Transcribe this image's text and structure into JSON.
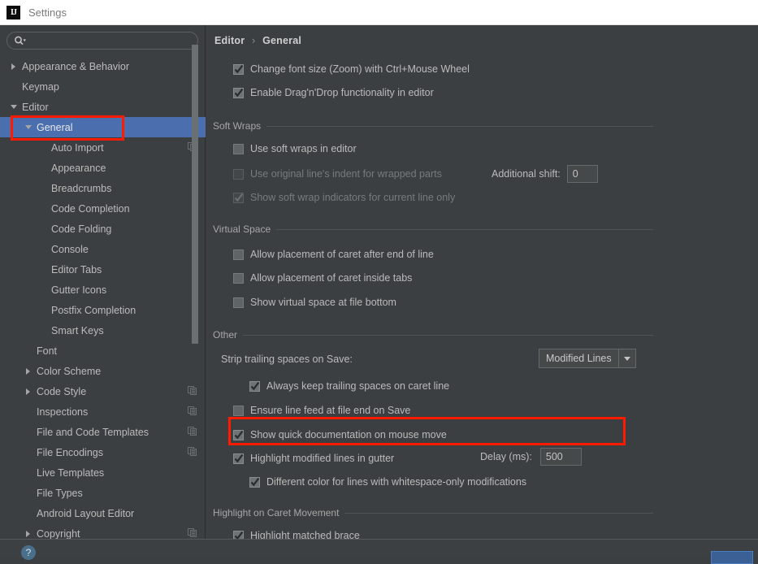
{
  "window": {
    "title": "Settings",
    "logo_text": "IJ"
  },
  "sidebar": {
    "search": {
      "placeholder": "",
      "value": "",
      "icon": "search-icon"
    },
    "items": [
      {
        "label": "Appearance & Behavior",
        "depth": 0,
        "arrow": "right",
        "selected": false,
        "copy": false
      },
      {
        "label": "Keymap",
        "depth": 0,
        "arrow": "none",
        "selected": false,
        "copy": false
      },
      {
        "label": "Editor",
        "depth": 0,
        "arrow": "down",
        "selected": false,
        "copy": false
      },
      {
        "label": "General",
        "depth": 1,
        "arrow": "down",
        "selected": true,
        "copy": false
      },
      {
        "label": "Auto Import",
        "depth": 2,
        "arrow": "none",
        "selected": false,
        "copy": true
      },
      {
        "label": "Appearance",
        "depth": 2,
        "arrow": "none",
        "selected": false,
        "copy": false
      },
      {
        "label": "Breadcrumbs",
        "depth": 2,
        "arrow": "none",
        "selected": false,
        "copy": false
      },
      {
        "label": "Code Completion",
        "depth": 2,
        "arrow": "none",
        "selected": false,
        "copy": false
      },
      {
        "label": "Code Folding",
        "depth": 2,
        "arrow": "none",
        "selected": false,
        "copy": false
      },
      {
        "label": "Console",
        "depth": 2,
        "arrow": "none",
        "selected": false,
        "copy": false
      },
      {
        "label": "Editor Tabs",
        "depth": 2,
        "arrow": "none",
        "selected": false,
        "copy": false
      },
      {
        "label": "Gutter Icons",
        "depth": 2,
        "arrow": "none",
        "selected": false,
        "copy": false
      },
      {
        "label": "Postfix Completion",
        "depth": 2,
        "arrow": "none",
        "selected": false,
        "copy": false
      },
      {
        "label": "Smart Keys",
        "depth": 2,
        "arrow": "none",
        "selected": false,
        "copy": false
      },
      {
        "label": "Font",
        "depth": 1,
        "arrow": "none",
        "selected": false,
        "copy": false
      },
      {
        "label": "Color Scheme",
        "depth": 1,
        "arrow": "right",
        "selected": false,
        "copy": false
      },
      {
        "label": "Code Style",
        "depth": 1,
        "arrow": "right",
        "selected": false,
        "copy": true
      },
      {
        "label": "Inspections",
        "depth": 1,
        "arrow": "none",
        "selected": false,
        "copy": true
      },
      {
        "label": "File and Code Templates",
        "depth": 1,
        "arrow": "none",
        "selected": false,
        "copy": true
      },
      {
        "label": "File Encodings",
        "depth": 1,
        "arrow": "none",
        "selected": false,
        "copy": true
      },
      {
        "label": "Live Templates",
        "depth": 1,
        "arrow": "none",
        "selected": false,
        "copy": false
      },
      {
        "label": "File Types",
        "depth": 1,
        "arrow": "none",
        "selected": false,
        "copy": false
      },
      {
        "label": "Android Layout Editor",
        "depth": 1,
        "arrow": "none",
        "selected": false,
        "copy": false
      },
      {
        "label": "Copyright",
        "depth": 1,
        "arrow": "right",
        "selected": false,
        "copy": true
      }
    ]
  },
  "main": {
    "breadcrumb": {
      "root": "Editor",
      "separator": "›",
      "leaf": "General"
    },
    "top_options": [
      {
        "label": "Change font size (Zoom) with Ctrl+Mouse Wheel",
        "checked": true,
        "enabled": true
      },
      {
        "label": "Enable Drag'n'Drop functionality in editor",
        "checked": true,
        "enabled": true
      }
    ],
    "sections": [
      {
        "title": "Soft Wraps",
        "options": [
          {
            "label": "Use soft wraps in editor",
            "checked": false,
            "enabled": true
          },
          {
            "label": "Use original line's indent for wrapped parts",
            "checked": false,
            "enabled": false
          },
          {
            "label": "Show soft wrap indicators for current line only",
            "checked": true,
            "enabled": false
          }
        ]
      },
      {
        "title": "Virtual Space",
        "options": [
          {
            "label": "Allow placement of caret after end of line",
            "checked": false,
            "enabled": true
          },
          {
            "label": "Allow placement of caret inside tabs",
            "checked": false,
            "enabled": true
          },
          {
            "label": "Show virtual space at file bottom",
            "checked": false,
            "enabled": true
          }
        ]
      },
      {
        "title": "Other",
        "options": [
          {
            "label": "Always keep trailing spaces on caret line",
            "checked": true,
            "enabled": true
          },
          {
            "label": "Ensure line feed at file end on Save",
            "checked": false,
            "enabled": true
          },
          {
            "label": "Show quick documentation on mouse move",
            "checked": true,
            "enabled": true
          },
          {
            "label": "Highlight modified lines in gutter",
            "checked": true,
            "enabled": true
          },
          {
            "label": "Different color for lines with whitespace-only modifications",
            "checked": true,
            "enabled": true
          }
        ]
      },
      {
        "title": "Highlight on Caret Movement",
        "options": [
          {
            "label": "Highlight matched brace",
            "checked": true,
            "enabled": true
          }
        ]
      }
    ],
    "soft_wraps_additional_shift": {
      "label": "Additional shift:",
      "value": "0"
    },
    "strip_trailing": {
      "label": "Strip trailing spaces on Save:",
      "value": "Modified Lines"
    },
    "quick_doc_delay": {
      "label": "Delay (ms):",
      "value": "500"
    }
  },
  "annotations": {
    "highlight_color": "#ff1a00",
    "boxes": [
      {
        "name": "general-tree-item-highlight"
      },
      {
        "name": "quick-documentation-row-highlight"
      }
    ]
  },
  "footer": {
    "help_icon": "question-mark-icon",
    "ok_button": ""
  },
  "colors": {
    "background": "#3c3f41",
    "selection": "#4b6eaf",
    "text": "#bbbbbb",
    "titlebar": "#ffffff"
  }
}
